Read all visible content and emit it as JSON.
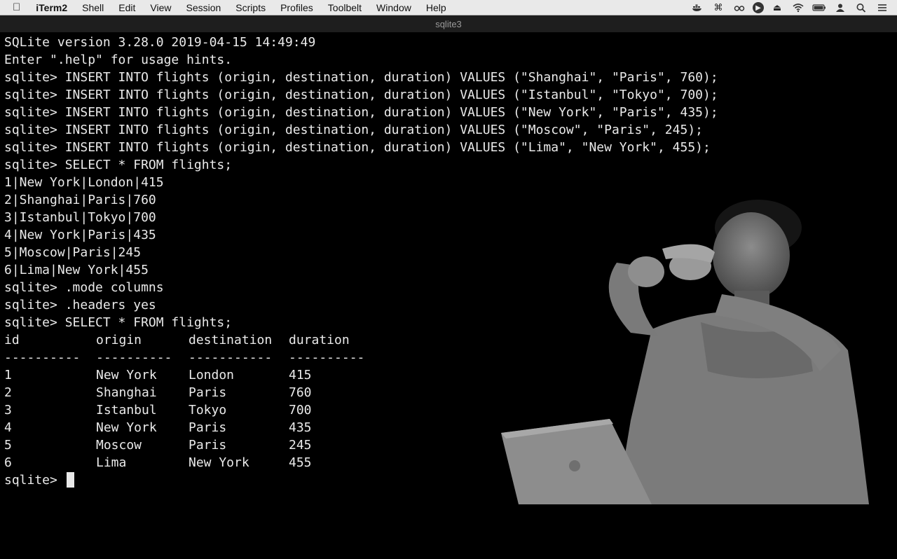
{
  "menubar": {
    "apple_icon": "apple-icon",
    "app_name": "iTerm2",
    "items": [
      "Shell",
      "Edit",
      "View",
      "Session",
      "Scripts",
      "Profiles",
      "Toolbelt",
      "Window",
      "Help"
    ],
    "status_icons": [
      "docker-icon",
      "command-icon",
      "glasses-icon",
      "play-circle-icon",
      "eject-icon",
      "wifi-icon",
      "battery-icon",
      "user-icon",
      "search-icon",
      "list-icon"
    ]
  },
  "window": {
    "title": "sqlite3"
  },
  "terminal": {
    "lines": [
      "SQLite version 3.28.0 2019-04-15 14:49:49",
      "Enter \".help\" for usage hints.",
      "sqlite> INSERT INTO flights (origin, destination, duration) VALUES (\"Shanghai\", \"Paris\", 760);",
      "sqlite> INSERT INTO flights (origin, destination, duration) VALUES (\"Istanbul\", \"Tokyo\", 700);",
      "sqlite> INSERT INTO flights (origin, destination, duration) VALUES (\"New York\", \"Paris\", 435);",
      "sqlite> INSERT INTO flights (origin, destination, duration) VALUES (\"Moscow\", \"Paris\", 245);",
      "sqlite> INSERT INTO flights (origin, destination, duration) VALUES (\"Lima\", \"New York\", 455);",
      "sqlite> SELECT * FROM flights;",
      "1|New York|London|415",
      "2|Shanghai|Paris|760",
      "3|Istanbul|Tokyo|700",
      "4|New York|Paris|435",
      "5|Moscow|Paris|245",
      "6|Lima|New York|455",
      "sqlite> .mode columns",
      "sqlite> .headers yes",
      "sqlite> SELECT * FROM flights;"
    ],
    "table": {
      "headers": [
        "id",
        "origin",
        "destination",
        "duration"
      ],
      "separators": [
        "----------",
        "----------",
        "-----------",
        "----------"
      ],
      "rows": [
        [
          "1",
          "New York",
          "London",
          "415"
        ],
        [
          "2",
          "Shanghai",
          "Paris",
          "760"
        ],
        [
          "3",
          "Istanbul",
          "Tokyo",
          "700"
        ],
        [
          "4",
          "New York",
          "Paris",
          "435"
        ],
        [
          "5",
          "Moscow",
          "Paris",
          "245"
        ],
        [
          "6",
          "Lima",
          "New York",
          "455"
        ]
      ]
    },
    "prompt": "sqlite> "
  }
}
